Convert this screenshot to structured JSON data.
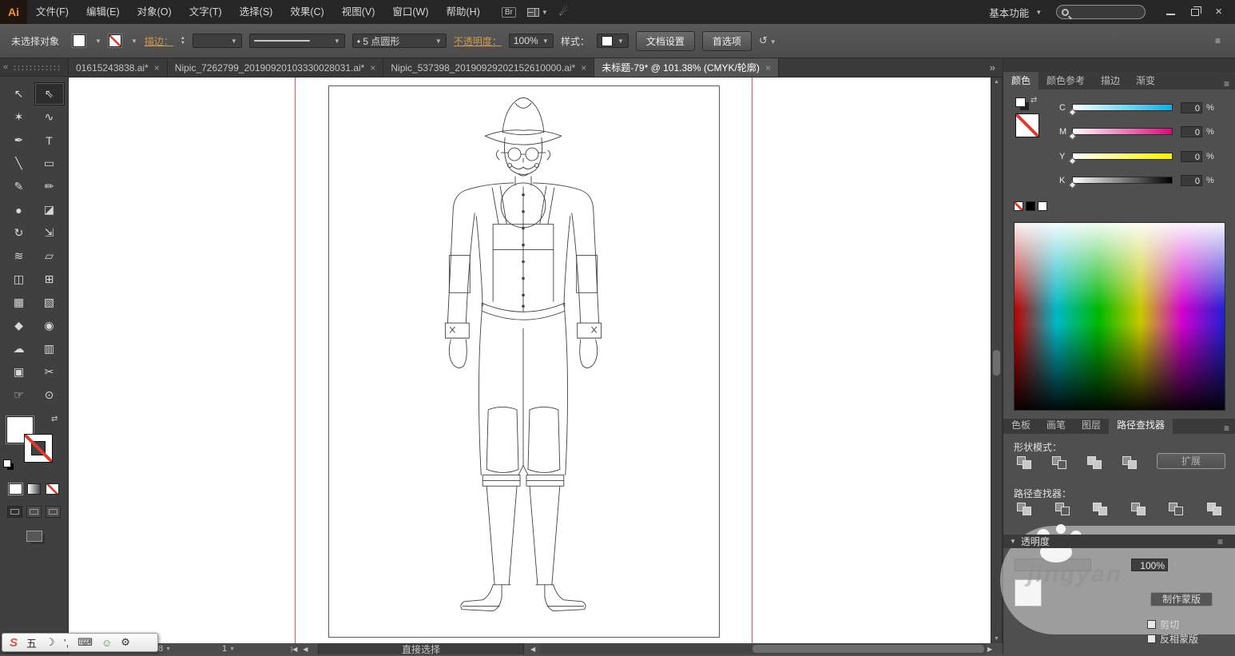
{
  "titlebar": {
    "logo": "Ai",
    "menus": [
      "文件(F)",
      "编辑(E)",
      "对象(O)",
      "文字(T)",
      "选择(S)",
      "效果(C)",
      "视图(V)",
      "窗口(W)",
      "帮助(H)"
    ],
    "bridge": "Br",
    "workspace": "基本功能",
    "window_controls": {
      "close": "×"
    }
  },
  "controlbar": {
    "selection_status": "未选择对象",
    "stroke_link": "描边：",
    "brush_value": "• 5 点圆形",
    "opacity_link": "不透明度：",
    "opacity_value": "100%",
    "style_label": "样式：",
    "document_setup": "文档设置",
    "preferences": "首选项"
  },
  "doc_tabs": {
    "tabs": [
      {
        "label": "01615243838.ai*"
      },
      {
        "label": "Nipic_7262799_20190920103330028031.ai*"
      },
      {
        "label": "Nipic_537398_20190929202152610000.ai*"
      },
      {
        "label": "未标题-79* @ 101.38% (CMYK/轮廓)"
      }
    ],
    "close_glyph": "×",
    "overflow_glyph": "»"
  },
  "toolbox": {
    "tools": [
      {
        "name": "selection-tool",
        "glyph": "↖"
      },
      {
        "name": "direct-selection-tool",
        "glyph": "⇖"
      },
      {
        "name": "magic-wand-tool",
        "glyph": "✶"
      },
      {
        "name": "lasso-tool",
        "glyph": "∿"
      },
      {
        "name": "pen-tool",
        "glyph": "✒"
      },
      {
        "name": "type-tool",
        "glyph": "T"
      },
      {
        "name": "line-segment-tool",
        "glyph": "╲"
      },
      {
        "name": "rectangle-tool",
        "glyph": "▭"
      },
      {
        "name": "paintbrush-tool",
        "glyph": "✎"
      },
      {
        "name": "pencil-tool",
        "glyph": "✏"
      },
      {
        "name": "blob-brush-tool",
        "glyph": "●"
      },
      {
        "name": "eraser-tool",
        "glyph": "◪"
      },
      {
        "name": "rotate-tool",
        "glyph": "↻"
      },
      {
        "name": "scale-tool",
        "glyph": "⇲"
      },
      {
        "name": "width-tool",
        "glyph": "≋"
      },
      {
        "name": "free-transform-tool",
        "glyph": "▱"
      },
      {
        "name": "shape-builder-tool",
        "glyph": "◫"
      },
      {
        "name": "perspective-grid-tool",
        "glyph": "⊞"
      },
      {
        "name": "mesh-tool",
        "glyph": "▦"
      },
      {
        "name": "gradient-tool",
        "glyph": "▧"
      },
      {
        "name": "eyedropper-tool",
        "glyph": "◆"
      },
      {
        "name": "blend-tool",
        "glyph": "◉"
      },
      {
        "name": "symbol-sprayer-tool",
        "glyph": "☁"
      },
      {
        "name": "column-graph-tool",
        "glyph": "▥"
      },
      {
        "name": "artboard-tool",
        "glyph": "▣"
      },
      {
        "name": "slice-tool",
        "glyph": "✂"
      },
      {
        "name": "hand-tool",
        "glyph": "☞"
      },
      {
        "name": "zoom-tool",
        "glyph": "⊙"
      }
    ]
  },
  "color_panel": {
    "tabs": [
      "颜色",
      "颜色参考",
      "描边",
      "渐变"
    ],
    "sliders": [
      {
        "channel": "C",
        "value": "0",
        "unit": "%",
        "color": "#00b6e3"
      },
      {
        "channel": "M",
        "value": "0",
        "unit": "%",
        "color": "#e6007e"
      },
      {
        "channel": "Y",
        "value": "0",
        "unit": "%",
        "color": "#fff100"
      },
      {
        "channel": "K",
        "value": "0",
        "unit": "%",
        "color": "#000000"
      }
    ]
  },
  "panel_tabs": {
    "tabs": [
      "色板",
      "画笔",
      "图层",
      "路径查找器"
    ]
  },
  "pathfinder": {
    "shape_mode_label": "形状模式：",
    "expand_button": "扩展",
    "pathfinder_label": "路径查找器："
  },
  "transparency": {
    "title": "透明度",
    "opacity_value": "100%",
    "make_mask": "制作蒙版",
    "clip_label": "剪切",
    "invert_mask_label": "反相蒙版"
  },
  "statusbar": {
    "zoom_partial": "8",
    "artboard_number": "1",
    "tool_status": "直接选择"
  },
  "ime_bar": {
    "logo": "S",
    "mode": "五",
    "moon": "☽",
    "punct": "’,",
    "keyboard": "⌨",
    "person": "☺",
    "tools": "⚙"
  },
  "watermark": {
    "text": "jingyan"
  }
}
